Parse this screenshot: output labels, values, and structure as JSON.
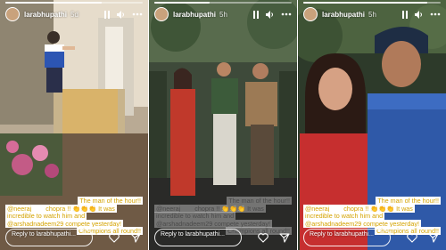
{
  "stories": [
    {
      "username": "larabhupathi",
      "time": "5d",
      "progress": 0.7,
      "caption": {
        "title": "The man of the hour!!",
        "mention1": "@neeraj____chopra",
        "line2_rest": " !! 👏👏👏 It was",
        "line3": "incredible to watch him and",
        "mention2": "@arshadnadeem29",
        "line4_rest": " compete yesterday!",
        "line5": "Champions all round!!"
      },
      "reply_label": "Reply to larabhupathi..."
    },
    {
      "username": "larabhupathi",
      "time": "5h",
      "progress": 0.4,
      "caption": {
        "title": "The man of the hour!!",
        "mention1": "@neeraj____chopra",
        "line2_rest": " !! 👏👏👏 It was",
        "line3": "incredible to watch him and",
        "mention2": "@arshadnadeem29",
        "line4_rest": " compete yesterday!",
        "line5": "Champions all round!!"
      },
      "reply_label": "Reply to larabhupathi..."
    },
    {
      "username": "larabhupathi",
      "time": "5h",
      "progress": 0.9,
      "caption": {
        "title": "The man of the hour!!",
        "mention1": "@neeraj____chopra",
        "line2_rest": " !! 👏👏👏 It was",
        "line3": "incredible to watch him and",
        "mention2": "@arshadnadeem29",
        "line4_rest": " compete yesterday!",
        "line5": "Champions all round!!"
      },
      "reply_label": "Reply to larabhupathi..."
    }
  ],
  "icons": {
    "pause": "pause-icon",
    "mute": "speaker-icon",
    "more": "more-dots-icon",
    "like": "heart-icon",
    "share": "send-icon"
  },
  "colors": {
    "caption_highlight": "#ffffff",
    "mention": "#d4a300",
    "reply_border": "#ffffff"
  }
}
